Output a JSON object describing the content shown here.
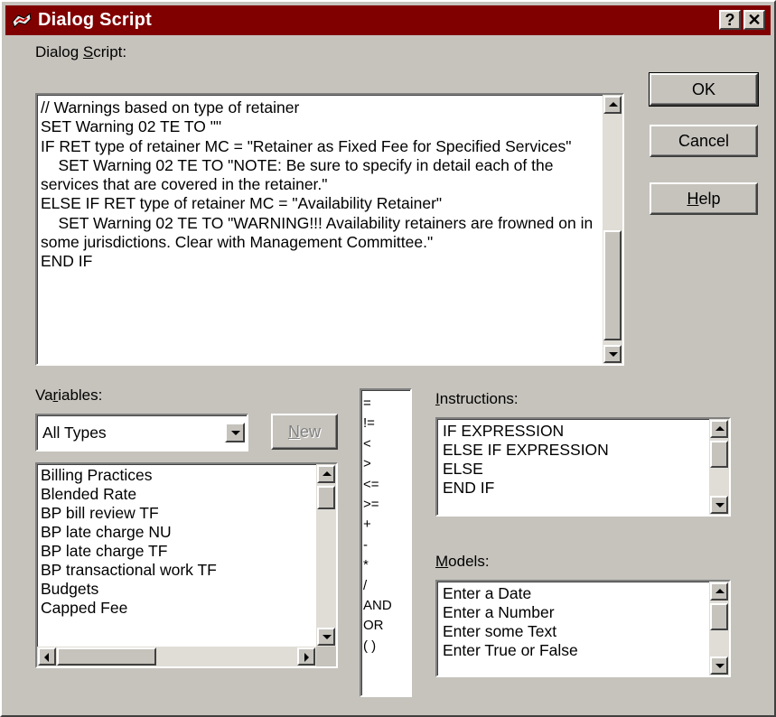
{
  "window": {
    "title": "Dialog Script",
    "help_btn": "?",
    "close_btn": "✕"
  },
  "script_label": {
    "pre": "Dialog ",
    "key": "S",
    "post": "cript:"
  },
  "script_lines": "// Warnings based on type of retainer\nSET Warning 02 TE TO \"\"\nIF RET type of retainer MC = \"Retainer as Fixed Fee for Specified Services\"\n    SET Warning 02 TE TO \"NOTE: Be sure to specify in detail each of the services that are covered in the retainer.\"\nELSE IF RET type of retainer MC = \"Availability Retainer\"\n    SET Warning 02 TE TO \"WARNING!!! Availability retainers are frowned on in some jurisdictions. Clear with Management Committee.\"\nEND IF",
  "buttons": {
    "ok": "OK",
    "cancel": "Cancel",
    "help_key": "H",
    "help_rest": "elp",
    "new_key": "N",
    "new_rest": "ew"
  },
  "variables_label": {
    "pre": "Va",
    "key": "r",
    "post": "iables:"
  },
  "variable_type": "All Types",
  "variables": [
    "Billing Practices",
    "Blended Rate",
    "BP bill review TF",
    "BP late charge NU",
    "BP late charge TF",
    "BP transactional work TF",
    "Budgets",
    "Capped Fee"
  ],
  "operators": [
    "=",
    "!=",
    "<",
    ">",
    "<=",
    ">=",
    "+",
    "-",
    "*",
    "/",
    "AND",
    "OR",
    "( )"
  ],
  "instructions_label": {
    "key": "I",
    "post": "nstructions:"
  },
  "instructions": [
    "IF EXPRESSION",
    "ELSE IF EXPRESSION",
    "ELSE",
    "END IF"
  ],
  "models_label": {
    "key": "M",
    "post": "odels:"
  },
  "models": [
    "Enter a Date",
    "Enter a Number",
    "Enter some Text",
    "Enter True or False"
  ],
  "colors": {
    "titlebar": "#800000",
    "face": "#c6c3bd"
  }
}
